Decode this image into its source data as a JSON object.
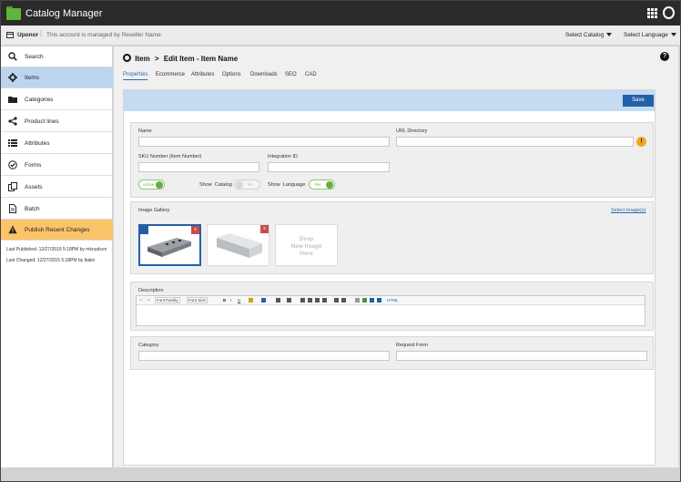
{
  "app": {
    "title": "Catalog Manager",
    "account_name": "Uponor",
    "account_note": "This account is managed by Reseller Name",
    "select_catalog": "Select Catalog",
    "select_language": "Select Language"
  },
  "sidebar": {
    "items": [
      {
        "label": "Search",
        "icon": "search-icon"
      },
      {
        "label": "Items",
        "icon": "gear-icon",
        "active": true
      },
      {
        "label": "Categories",
        "icon": "folder-icon"
      },
      {
        "label": "Product lines",
        "icon": "share-icon"
      },
      {
        "label": "Attributes",
        "icon": "list-icon"
      },
      {
        "label": "Forms",
        "icon": "check-icon"
      },
      {
        "label": "Assets",
        "icon": "copy-icon"
      },
      {
        "label": "Batch",
        "icon": "document-icon"
      },
      {
        "label": "Publish Recent Changes",
        "icon": "warning-icon"
      }
    ],
    "last_published": "Last Published: 12/27/2016 5:18PM by mknudson",
    "last_changed": "Last Changed: 12/27/2016 5:18PM by tlakin"
  },
  "header": {
    "breadcrumb_root": "Item",
    "breadcrumb_sep": ">",
    "breadcrumb_current": "Edit Item - Item Name"
  },
  "tabs": [
    "Properties",
    "Ecommerce",
    "Attributes",
    "Options",
    "Downloads",
    "SEO",
    "CAD"
  ],
  "save_label": "Save",
  "form": {
    "name_label": "Name",
    "url_label": "URL Directory",
    "sku_label": "SKU Number (Item Number)",
    "integration_label": "Integration ID",
    "active_toggle": "Active",
    "show_catalog_label": "Show",
    "catalog_word": "Catalog",
    "catalog_toggle": "No",
    "show_language_label": "Show",
    "language_word": "Language",
    "language_toggle": "Yes",
    "warn_symbol": "!"
  },
  "gallery": {
    "label": "Image Gallery",
    "select_link": "Select Image(s)",
    "remove": "x",
    "drop_text_1": "Drop",
    "drop_text_2": "New Image",
    "drop_text_3": "Here"
  },
  "description": {
    "label": "Description",
    "font_family": "Font Family",
    "font_size": "Font Size",
    "bold": "B",
    "italic": "I",
    "underline": "U",
    "html": "HTML"
  },
  "bottom_form": {
    "category_label": "Category",
    "request_form_label": "Request Form"
  },
  "colors": {
    "accent": "#2360a8",
    "active_nav": "#bcd4ee",
    "publish": "#fbc36a",
    "toggle_on": "#6aae43"
  }
}
